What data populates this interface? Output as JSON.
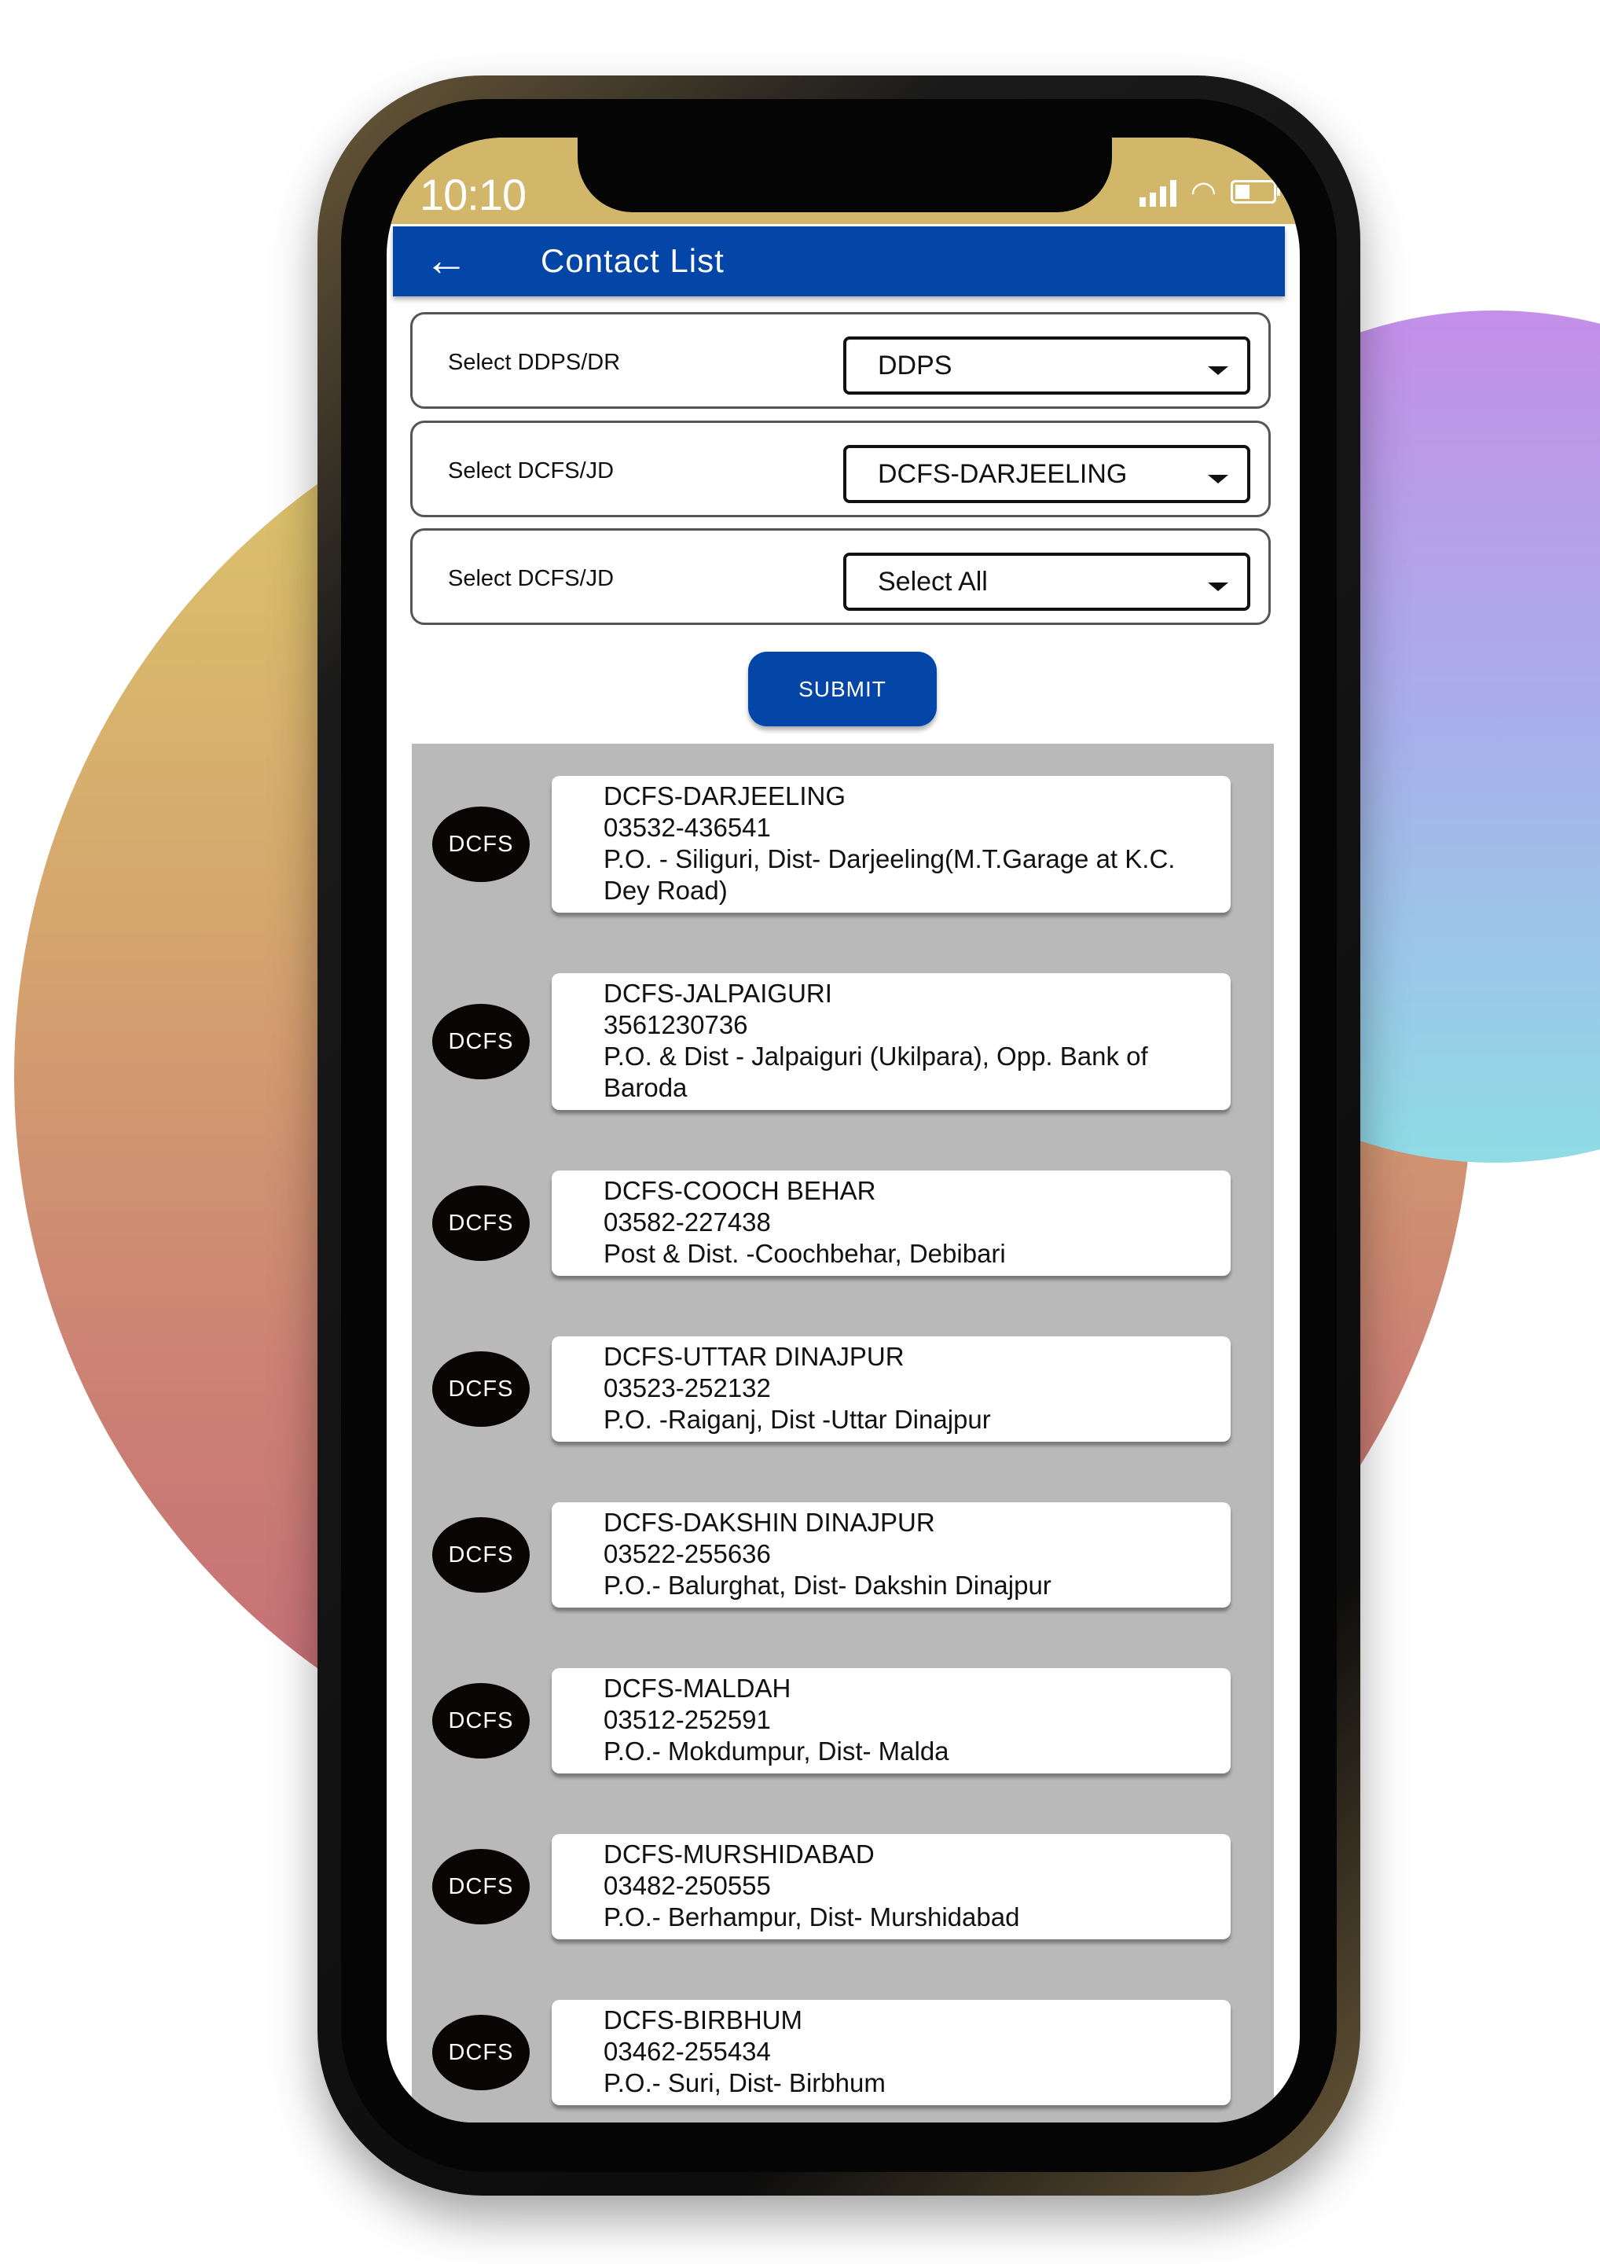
{
  "status_bar": {
    "time": "10:10",
    "icons": [
      "signal-icon",
      "wifi-icon",
      "battery-icon"
    ]
  },
  "app_bar": {
    "title": "Contact List",
    "back_icon": "arrow-left-icon"
  },
  "form": {
    "rows": [
      {
        "label": "Select DDPS/DR",
        "value": "DDPS"
      },
      {
        "label": "Select DCFS/JD",
        "value": "DCFS-DARJEELING"
      },
      {
        "label": "Select DCFS/JD",
        "value": "Select All"
      }
    ],
    "submit_label": "SUBMIT"
  },
  "contacts": [
    {
      "badge": "DCFS",
      "name": "DCFS-DARJEELING",
      "phone": "03532-436541",
      "address": "P.O. - Siliguri, Dist- Darjeeling(M.T.Garage at K.C. Dey Road)"
    },
    {
      "badge": "DCFS",
      "name": "DCFS-JALPAIGURI",
      "phone": "3561230736",
      "address": "P.O. & Dist - Jalpaiguri (Ukilpara), Opp. Bank of Baroda"
    },
    {
      "badge": "DCFS",
      "name": "DCFS-COOCH BEHAR",
      "phone": "03582-227438",
      "address": "Post & Dist. -Coochbehar, Debibari"
    },
    {
      "badge": "DCFS",
      "name": "DCFS-UTTAR DINAJPUR",
      "phone": "03523-252132",
      "address": "P.O. -Raiganj, Dist -Uttar Dinajpur"
    },
    {
      "badge": "DCFS",
      "name": "DCFS-DAKSHIN DINAJPUR",
      "phone": "03522-255636",
      "address": "P.O.- Balurghat, Dist- Dakshin Dinajpur"
    },
    {
      "badge": "DCFS",
      "name": "DCFS-MALDAH",
      "phone": "03512-252591",
      "address": "P.O.- Mokdumpur, Dist- Malda"
    },
    {
      "badge": "DCFS",
      "name": "DCFS-MURSHIDABAD",
      "phone": "03482-250555",
      "address": "P.O.- Berhampur, Dist- Murshidabad"
    },
    {
      "badge": "DCFS",
      "name": "DCFS-BIRBHUM",
      "phone": "03462-255434",
      "address": "P.O.- Suri, Dist- Birbhum"
    }
  ],
  "colors": {
    "primary": "#0446a8",
    "status_bar": "#d2b66a",
    "list_bg": "#b9b9b9",
    "avatar": "#0a0505"
  }
}
